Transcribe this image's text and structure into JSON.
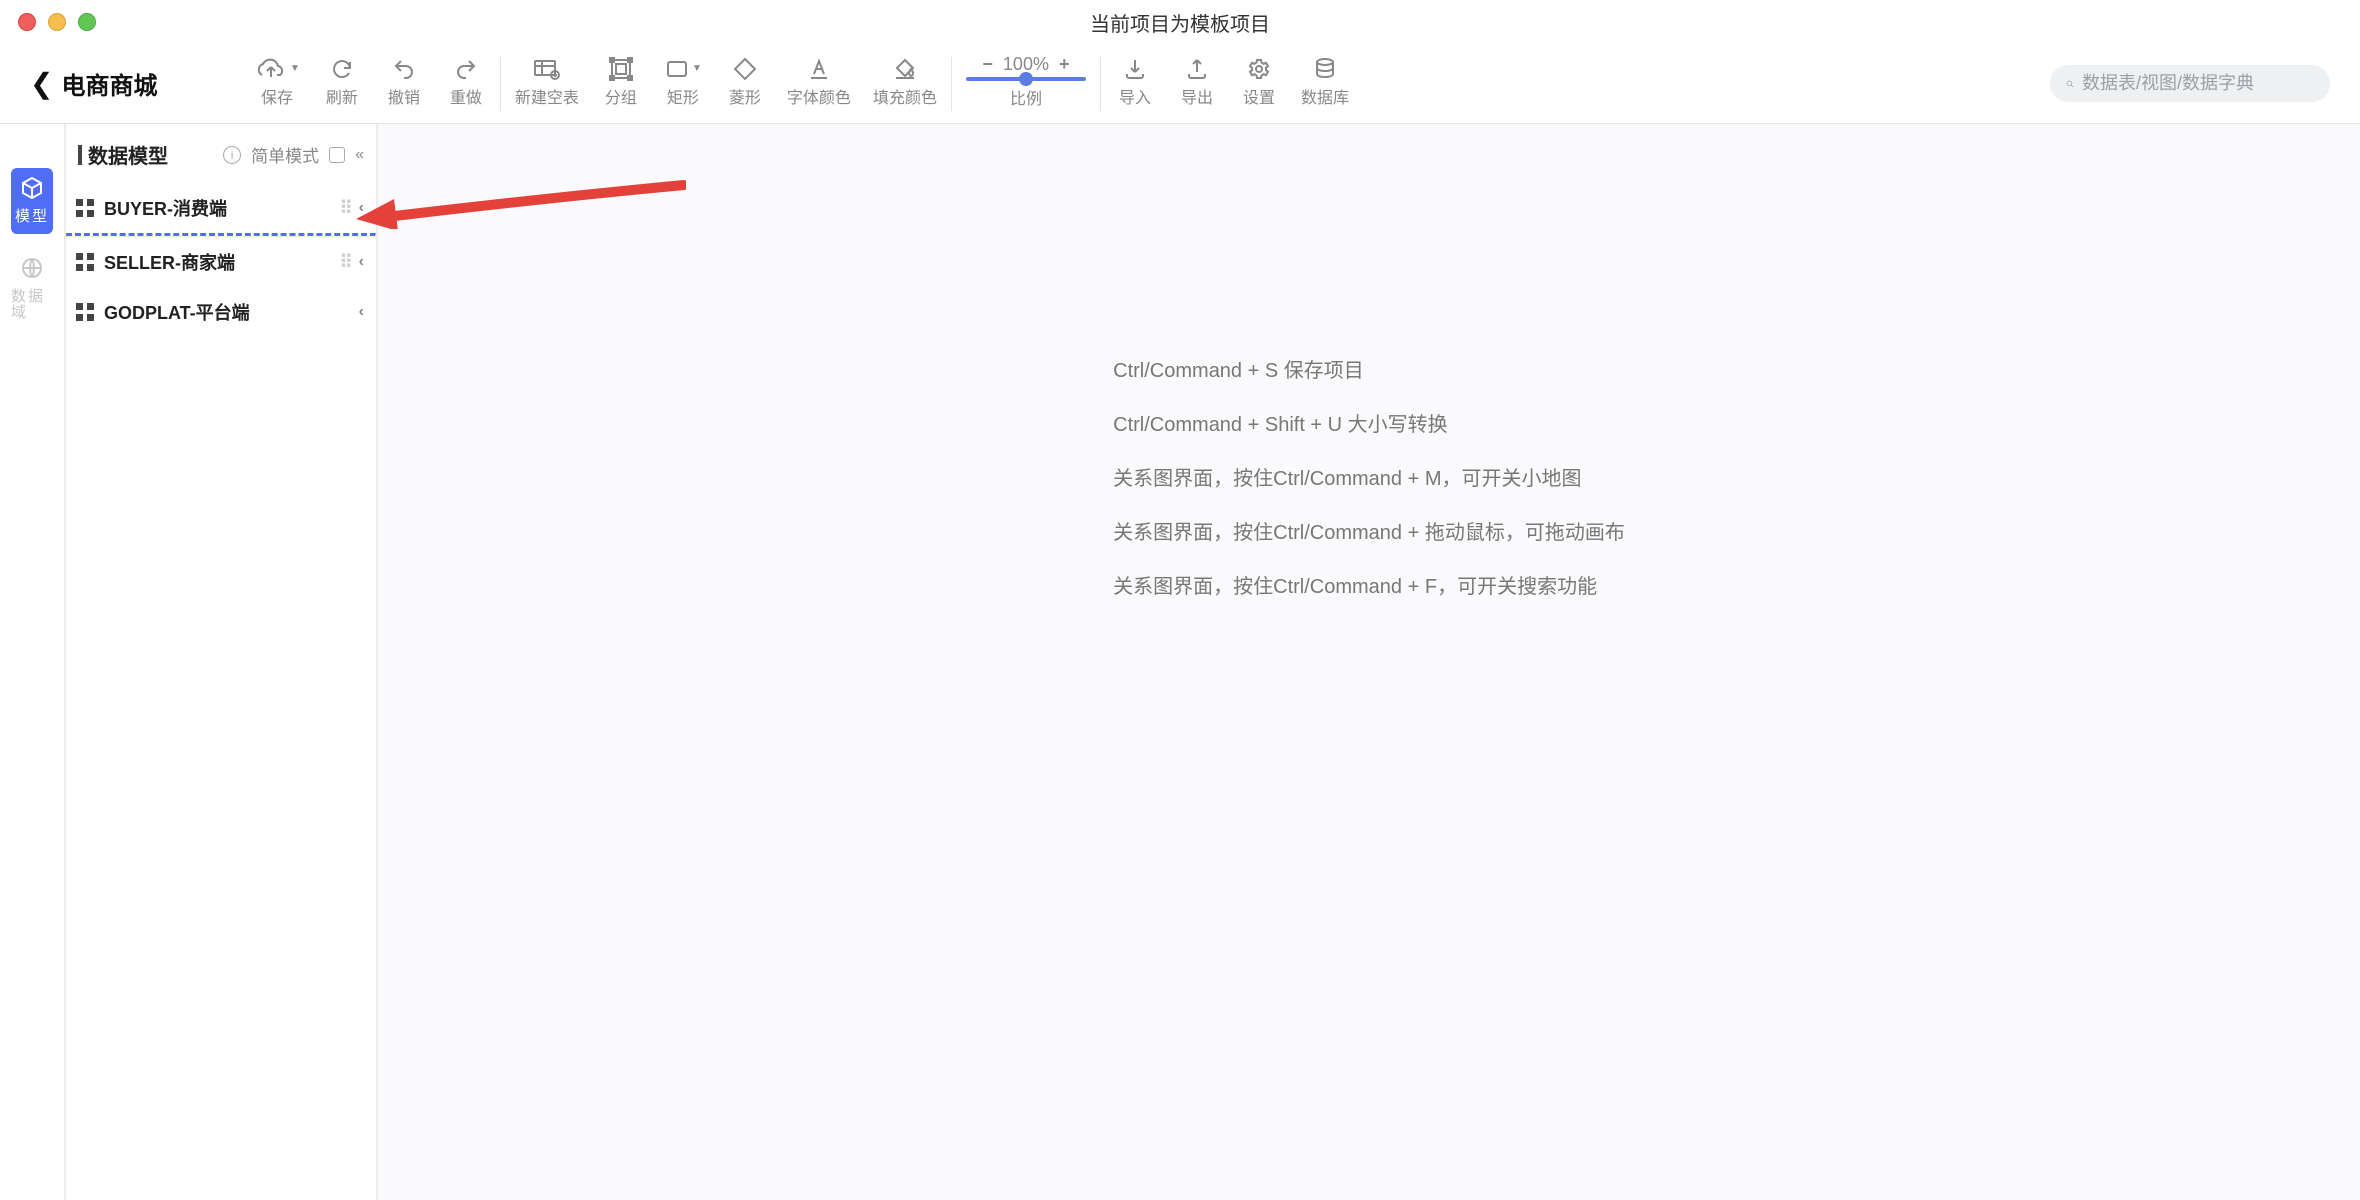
{
  "window": {
    "title": "当前项目为模板项目"
  },
  "header": {
    "project_name": "电商商城"
  },
  "toolbar": {
    "save": "保存",
    "refresh": "刷新",
    "undo": "撤销",
    "redo": "重做",
    "new_table": "新建空表",
    "group": "分组",
    "rect": "矩形",
    "diamond": "菱形",
    "font_color": "字体颜色",
    "fill_color": "填充颜色",
    "zoom": {
      "value": "100%",
      "label": "比例"
    },
    "import": "导入",
    "export": "导出",
    "settings": "设置",
    "database": "数据库"
  },
  "search": {
    "placeholder": "数据表/视图/数据字典"
  },
  "rail": {
    "model": "模型",
    "domain": "数据域"
  },
  "sidebar": {
    "title": "数据模型",
    "mode_label": "简单模式",
    "items": [
      {
        "name": "BUYER-消费端"
      },
      {
        "name": "SELLER-商家端"
      },
      {
        "name": "GODPLAT-平台端"
      }
    ]
  },
  "hints": [
    "Ctrl/Command + S 保存项目",
    "Ctrl/Command + Shift + U 大小写转换",
    "关系图界面，按住Ctrl/Command + M，可开关小地图",
    "关系图界面，按住Ctrl/Command + 拖动鼠标，可拖动画布",
    "关系图界面，按住Ctrl/Command + F，可开关搜索功能"
  ]
}
